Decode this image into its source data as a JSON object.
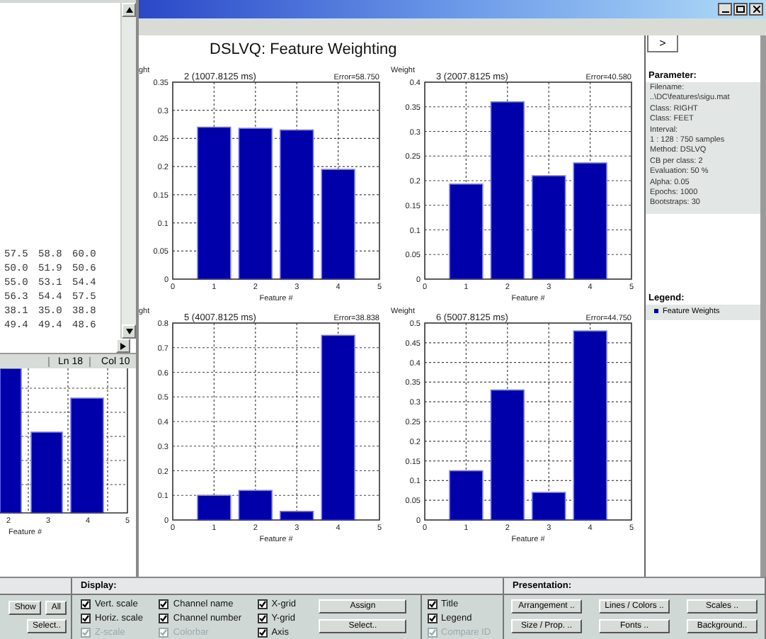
{
  "editor": {
    "rows": [
      [
        "57.5",
        "58.8",
        "60.0"
      ],
      [
        "50.0",
        "51.9",
        "50.6"
      ],
      [
        "55.0",
        "53.1",
        "54.4"
      ],
      [
        "56.3",
        "54.4",
        "57.5"
      ],
      [
        "38.1",
        "35.0",
        "38.8"
      ],
      [
        "49.4",
        "49.4",
        "48.6"
      ]
    ],
    "status": {
      "line": "Ln 18",
      "column": "Col 10"
    }
  },
  "back_chart": {
    "xtick_labels": [
      "2",
      "3",
      "4",
      "5"
    ],
    "xlabel": "Feature #"
  },
  "figure": {
    "title": "DSLVQ: Feature Weighting",
    "plots": [
      {
        "error": "Error=58.750",
        "x_edge_labels": [
          "0",
          "5"
        ],
        "chart_data": {
          "type": "bar",
          "title": "2 (1007.8125 ms)",
          "ylabel": "ght",
          "xlabel": "Feature #",
          "categories": [
            "1",
            "2",
            "3",
            "4"
          ],
          "values": [
            0.27,
            0.268,
            0.265,
            0.195
          ],
          "grid": true,
          "ylim": [
            0,
            0.35
          ],
          "yticks": [
            0,
            0.05,
            0.1,
            0.15,
            0.2,
            0.25,
            0.3,
            0.35
          ]
        }
      },
      {
        "error": "Error=40.580",
        "x_edge_labels": [
          "0",
          "5"
        ],
        "chart_data": {
          "type": "bar",
          "title": "3 (2007.8125 ms)",
          "ylabel": "Weight",
          "xlabel": "Feature #",
          "categories": [
            "1",
            "2",
            "3",
            "4"
          ],
          "values": [
            0.193,
            0.36,
            0.21,
            0.236
          ],
          "grid": true,
          "ylim": [
            0,
            0.4
          ],
          "yticks": [
            0,
            0.05,
            0.1,
            0.15,
            0.2,
            0.25,
            0.3,
            0.35,
            0.4
          ]
        }
      },
      {
        "error": "Error=38.838",
        "x_edge_labels": [
          "0",
          "5"
        ],
        "chart_data": {
          "type": "bar",
          "title": "5 (4007.8125 ms)",
          "ylabel": "ght",
          "xlabel": "Feature #",
          "categories": [
            "1",
            "2",
            "3",
            "4"
          ],
          "values": [
            0.1,
            0.12,
            0.035,
            0.75
          ],
          "grid": true,
          "ylim": [
            0,
            0.8
          ],
          "yticks": [
            0,
            0.1,
            0.2,
            0.3,
            0.4,
            0.5,
            0.6,
            0.7,
            0.8
          ]
        }
      },
      {
        "error": "Error=44.750",
        "x_edge_labels": [
          "0",
          "5"
        ],
        "chart_data": {
          "type": "bar",
          "title": "6 (5007.8125 ms)",
          "ylabel": "Weight",
          "xlabel": "Feature #",
          "categories": [
            "1",
            "2",
            "3",
            "4"
          ],
          "values": [
            0.125,
            0.33,
            0.07,
            0.48
          ],
          "grid": true,
          "ylim": [
            0,
            0.5
          ],
          "yticks": [
            0,
            0.05,
            0.1,
            0.15,
            0.2,
            0.25,
            0.3,
            0.35,
            0.4,
            0.45,
            0.5
          ]
        }
      }
    ]
  },
  "side_panel": {
    "toggle": ">",
    "parameter_heading": "Parameter:",
    "parameters": [
      "Filename:",
      "..\\DC\\features\\sigu.mat",
      "Class: RIGHT",
      "Class: FEET",
      "Interval:",
      "1 : 128 : 750 samples",
      "Method: DSLVQ",
      "CB per class: 2",
      "Evaluation: 50 %",
      "Alpha: 0.05",
      "Epochs: 1000",
      "Bootstraps: 30"
    ],
    "legend_heading": "Legend:",
    "legend": [
      {
        "label": "Feature Weights",
        "color": "#0000aa"
      }
    ]
  },
  "bottom_panel": {
    "left_buttons": [
      [
        "Show",
        "All"
      ],
      [
        "Select.."
      ]
    ],
    "display": {
      "heading": "Display:",
      "columns": [
        [
          {
            "label": "Vert. scale",
            "checked": true,
            "disabled": false
          },
          {
            "label": "Horiz. scale",
            "checked": true,
            "disabled": false
          },
          {
            "label": "Z-scale",
            "checked": true,
            "disabled": true
          }
        ],
        [
          {
            "label": "Channel name",
            "checked": true,
            "disabled": false
          },
          {
            "label": "Channel number",
            "checked": true,
            "disabled": false
          },
          {
            "label": "Colorbar",
            "checked": true,
            "disabled": true
          }
        ],
        [
          {
            "label": "X-grid",
            "checked": true,
            "disabled": false
          },
          {
            "label": "Y-grid",
            "checked": true,
            "disabled": false
          },
          {
            "label": "Axis",
            "checked": true,
            "disabled": false
          }
        ]
      ],
      "buttons": [
        "Assign",
        "Select.."
      ],
      "extra_column": [
        {
          "label": "Title",
          "checked": true,
          "disabled": false
        },
        {
          "label": "Legend",
          "checked": true,
          "disabled": false
        },
        {
          "label": "Compare ID",
          "checked": true,
          "disabled": true
        }
      ]
    },
    "presentation": {
      "heading": "Presentation:",
      "buttons": [
        "Arrangement ..",
        "Lines / Colors ..",
        "Scales ..",
        "Size / Prop. ..",
        "Fonts ..",
        "Background.."
      ]
    }
  }
}
